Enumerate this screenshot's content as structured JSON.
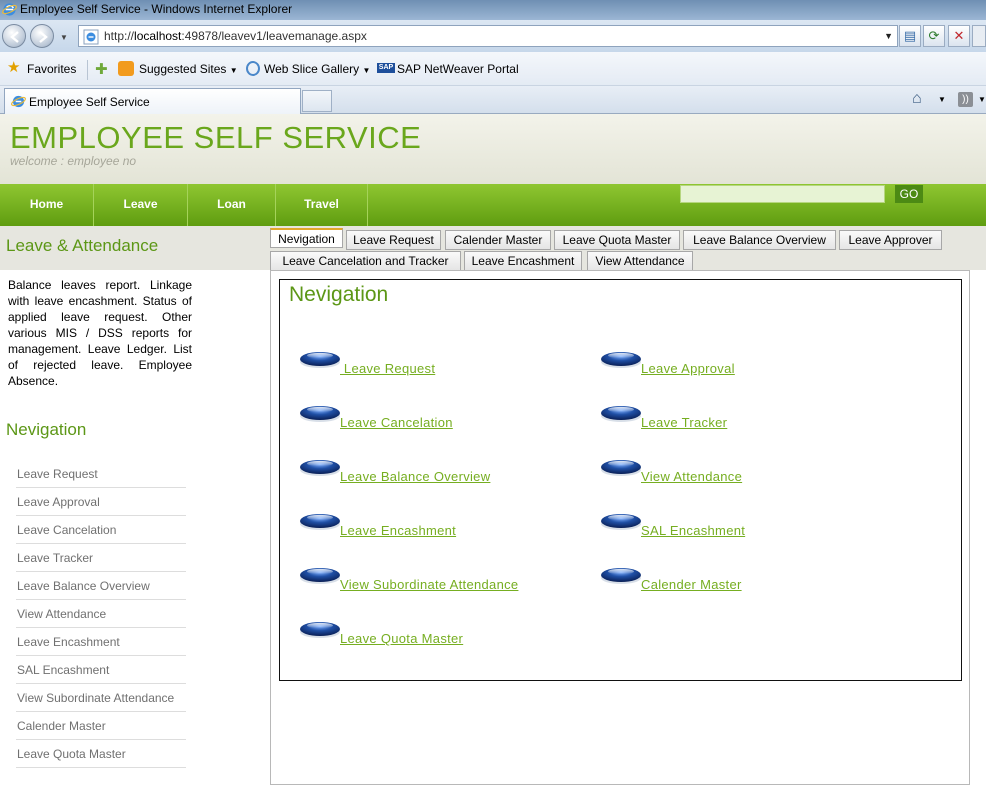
{
  "browser": {
    "window_title": "Employee Self Service - Windows Internet Explorer",
    "url_prefix": "http://",
    "url_host": "localhost",
    "url_rest": ":49878/leavev1/leavemanage.aspx",
    "favorites": {
      "label": "Favorites",
      "items": [
        "Suggested Sites",
        "Web Slice Gallery",
        "SAP NetWeaver Portal"
      ]
    },
    "tab_title": "Employee Self Service"
  },
  "header": {
    "brand": "EMPLOYEE SELF SERVICE",
    "welcome": "welcome : employee no"
  },
  "menu": {
    "items": [
      "Home",
      "Leave",
      "Loan",
      "Travel"
    ],
    "go_label": "GO",
    "search_value": ""
  },
  "sidebar": {
    "section_title": "Leave & Attendance",
    "description": "Balance leaves report. Linkage with leave encashment. Status of applied leave request. Other various MIS / DSS reports for management. Leave Ledger. List of rejected leave. Employee Absence.",
    "nav_title": "Nevigation",
    "items": [
      "Leave Request",
      "Leave Approval",
      "Leave Cancelation",
      "Leave Tracker",
      "Leave Balance Overview",
      "View Attendance",
      "Leave Encashment",
      "SAL Encashment",
      "View Subordinate Attendance",
      "Calender Master",
      "Leave Quota Master"
    ]
  },
  "page_tabs": {
    "active": "Nevigation",
    "row1": [
      "Nevigation",
      "Leave Request",
      "Calender Master",
      "Leave Quota Master",
      "Leave Balance Overview",
      "Leave Approver"
    ],
    "row2": [
      "Leave Cancelation and Tracker",
      "Leave Encashment",
      "View Attendance"
    ]
  },
  "content": {
    "title": "Nevigation",
    "links_left": [
      " Leave Request",
      "Leave Cancelation",
      "Leave Balance Overview",
      "Leave Encashment",
      "View Subordinate Attendance",
      "Leave Quota Master"
    ],
    "links_right": [
      "Leave Approval",
      "Leave Tracker",
      "View Attendance",
      "SAL Encashment",
      "Calender Master"
    ]
  },
  "colors": {
    "brand_green": "#6aa71c",
    "menu_green": "#6aa71c",
    "link_green": "#76ae21",
    "tab_accent": "#e2a72b"
  }
}
